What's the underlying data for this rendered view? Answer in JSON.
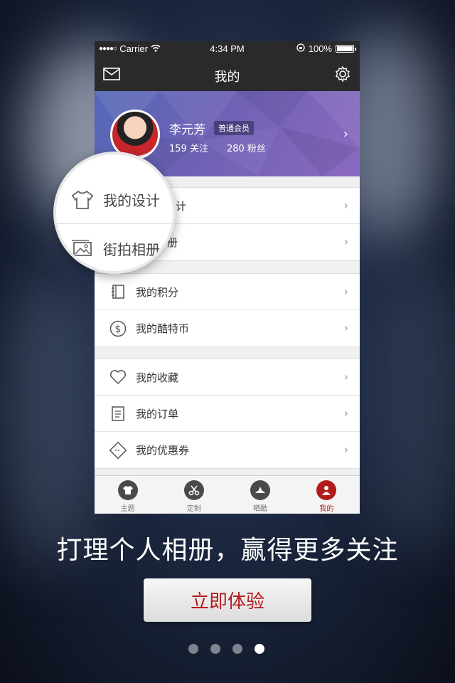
{
  "status_bar": {
    "carrier": "Carrier",
    "time": "4:34 PM",
    "battery": "100%"
  },
  "nav": {
    "title": "我的"
  },
  "profile": {
    "name": "李元芳",
    "badge": "普通会员",
    "following": "159 关注",
    "followers": "280 粉丝"
  },
  "groups": [
    {
      "items": [
        {
          "label": "我的设计",
          "icon": "shirt-icon"
        },
        {
          "label": "街拍相册",
          "icon": "photo-album-icon"
        }
      ]
    },
    {
      "items": [
        {
          "label": "我的积分",
          "icon": "notebook-icon"
        },
        {
          "label": "我的酷特币",
          "icon": "dollar-coin-icon"
        }
      ]
    },
    {
      "items": [
        {
          "label": "我的收藏",
          "icon": "heart-icon"
        },
        {
          "label": "我的订单",
          "icon": "order-list-icon"
        },
        {
          "label": "我的优惠券",
          "icon": "coupon-icon"
        }
      ]
    }
  ],
  "visible_row_labels": {
    "design_partial": "计",
    "album_partial": "册"
  },
  "magnifier": {
    "design": "我的设计",
    "album": "街拍相册"
  },
  "tabs": [
    {
      "label": "主题",
      "icon": "tshirt-tab-icon"
    },
    {
      "label": "定制",
      "icon": "scissors-tab-icon"
    },
    {
      "label": "晒酷",
      "icon": "hat-tab-icon"
    },
    {
      "label": "我的",
      "icon": "user-tab-icon",
      "active": true
    }
  ],
  "tagline": "打理个人相册，赢得更多关注",
  "cta_label": "立即体验",
  "pager": {
    "count": 4,
    "active_index": 3
  },
  "colors": {
    "accent": "#b31b1b",
    "nav_bg": "#2a2a2a",
    "profile_start": "#5468b7",
    "profile_end": "#8a6ac0"
  }
}
